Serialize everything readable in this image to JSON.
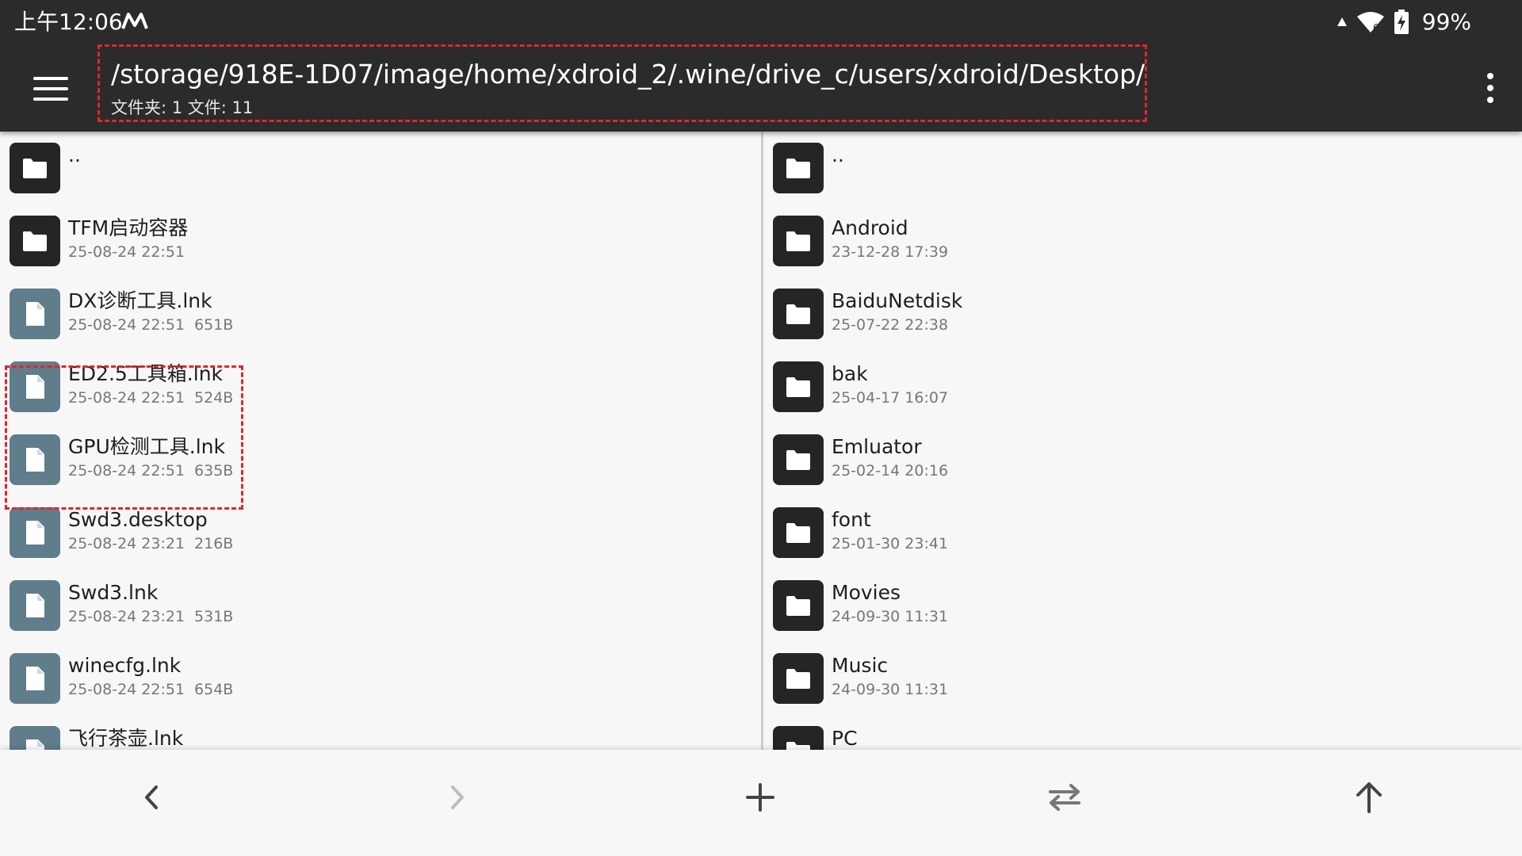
{
  "status_bar": {
    "time": "上午12:06",
    "app_indicator_icon": "m-logo-icon",
    "signal_icon": "data-arrow-icon",
    "wifi_icon": "wifi-6-icon",
    "battery_icon": "battery-charging-icon",
    "battery_percent": "99%"
  },
  "app_bar": {
    "menu_icon": "hamburger-menu-icon",
    "path": "/storage/918E-1D07/image/home/xdroid_2/.wine/drive_c/users/xdroid/Desktop/",
    "summary": "文件夹: 1  文件: 11",
    "more_icon": "more-vert-icon"
  },
  "left_pane": {
    "items": [
      {
        "type": "folder",
        "name": "..",
        "date": "",
        "size": ""
      },
      {
        "type": "folder",
        "name": "TFM启动容器",
        "date": "25-08-24 22:51",
        "size": ""
      },
      {
        "type": "file",
        "name": "DX诊断工具.lnk",
        "date": "25-08-24 22:51",
        "size": "651B"
      },
      {
        "type": "file",
        "name": "ED2.5工具箱.lnk",
        "date": "25-08-24 22:51",
        "size": "524B"
      },
      {
        "type": "file",
        "name": "GPU检测工具.lnk",
        "date": "25-08-24 22:51",
        "size": "635B"
      },
      {
        "type": "file",
        "name": "Swd3.desktop",
        "date": "25-08-24 23:21",
        "size": "216B"
      },
      {
        "type": "file",
        "name": "Swd3.lnk",
        "date": "25-08-24 23:21",
        "size": "531B"
      },
      {
        "type": "file",
        "name": "winecfg.lnk",
        "date": "25-08-24 22:51",
        "size": "654B"
      },
      {
        "type": "file",
        "name": "飞行茶壶.lnk",
        "date": "",
        "size": ""
      }
    ]
  },
  "right_pane": {
    "items": [
      {
        "type": "folder",
        "name": "..",
        "date": ""
      },
      {
        "type": "folder",
        "name": "Android",
        "date": "23-12-28 17:39"
      },
      {
        "type": "folder",
        "name": "BaiduNetdisk",
        "date": "25-07-22 22:38"
      },
      {
        "type": "folder",
        "name": "bak",
        "date": "25-04-17 16:07"
      },
      {
        "type": "folder",
        "name": "Emluator",
        "date": "25-02-14 20:16"
      },
      {
        "type": "folder",
        "name": "font",
        "date": "25-01-30 23:41"
      },
      {
        "type": "folder",
        "name": "Movies",
        "date": "24-09-30 11:31"
      },
      {
        "type": "folder",
        "name": "Music",
        "date": "24-09-30 11:31"
      },
      {
        "type": "folder",
        "name": "PC",
        "date": ""
      }
    ]
  },
  "bottom_bar": {
    "back_icon": "chevron-left-icon",
    "forward_icon": "chevron-right-icon",
    "add_icon": "plus-icon",
    "swap_icon": "swap-horizontal-icon",
    "up_icon": "arrow-up-icon"
  },
  "colors": {
    "bar_bg": "#2b2b2b",
    "folder_icon_bg": "#252525",
    "file_icon_bg": "#607d8b",
    "highlight": "#e0262a"
  }
}
